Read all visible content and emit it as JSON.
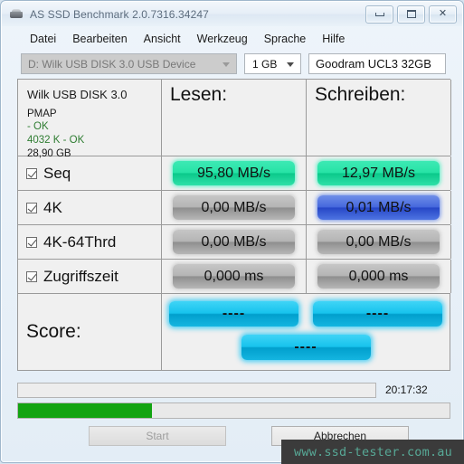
{
  "window": {
    "title": "AS SSD Benchmark 2.0.7316.34247",
    "icon": "ssd-drive-icon",
    "controls": {
      "minimize": "minimize-icon",
      "maximize": "restore-icon",
      "close": "✕"
    }
  },
  "menu": {
    "items": [
      {
        "label": "Datei"
      },
      {
        "label": "Bearbeiten"
      },
      {
        "label": "Ansicht"
      },
      {
        "label": "Werkzeug"
      },
      {
        "label": "Sprache"
      },
      {
        "label": "Hilfe"
      }
    ]
  },
  "selector": {
    "drive": {
      "value": "D: Wilk USB DISK 3.0 USB Device",
      "enabled": false
    },
    "size": {
      "value": "1 GB",
      "enabled": true
    },
    "name": {
      "value": "Goodram UCL3 32GB",
      "placeholder": ""
    }
  },
  "drive_info": {
    "model": "Wilk USB DISK 3.0",
    "firmware": "PMAP",
    "driver_status": " - OK",
    "alignment": "4032 K - OK",
    "capacity": "28,90 GB"
  },
  "table": {
    "columns": {
      "read": "Lesen:",
      "write": "Schreiben:"
    },
    "rows": [
      {
        "label": "Seq",
        "checked": true,
        "read": {
          "value": "95,80 MB/s",
          "color": "green"
        },
        "write": {
          "value": "12,97 MB/s",
          "color": "green"
        }
      },
      {
        "label": "4K",
        "checked": true,
        "read": {
          "value": "0,00 MB/s",
          "color": "gray"
        },
        "write": {
          "value": "0,01 MB/s",
          "color": "blue"
        }
      },
      {
        "label": "4K-64Thrd",
        "checked": true,
        "read": {
          "value": "0,00 MB/s",
          "color": "gray"
        },
        "write": {
          "value": "0,00 MB/s",
          "color": "gray"
        }
      },
      {
        "label": "Zugriffszeit",
        "checked": true,
        "read": {
          "value": "0,000 ms",
          "color": "gray"
        },
        "write": {
          "value": "0,000 ms",
          "color": "gray"
        }
      }
    ],
    "score": {
      "label": "Score:",
      "read": "----",
      "write": "----",
      "total": "----"
    }
  },
  "status": {
    "message": "",
    "timestamp": "20:17:32",
    "progress_percent": 31
  },
  "buttons": {
    "start": {
      "label": "Start",
      "enabled": false
    },
    "cancel": {
      "label": "Abbrechen",
      "enabled": true
    }
  },
  "watermark": {
    "text": "www.ssd-tester.com.au"
  },
  "colors": {
    "green_pill": "#27e3a6",
    "blue_pill": "#4668dd",
    "gray_pill": "#b5b5b5",
    "cyan_pill": "#17c3ed",
    "progress_green": "#13a412",
    "ok_text": "#2f7d32"
  }
}
